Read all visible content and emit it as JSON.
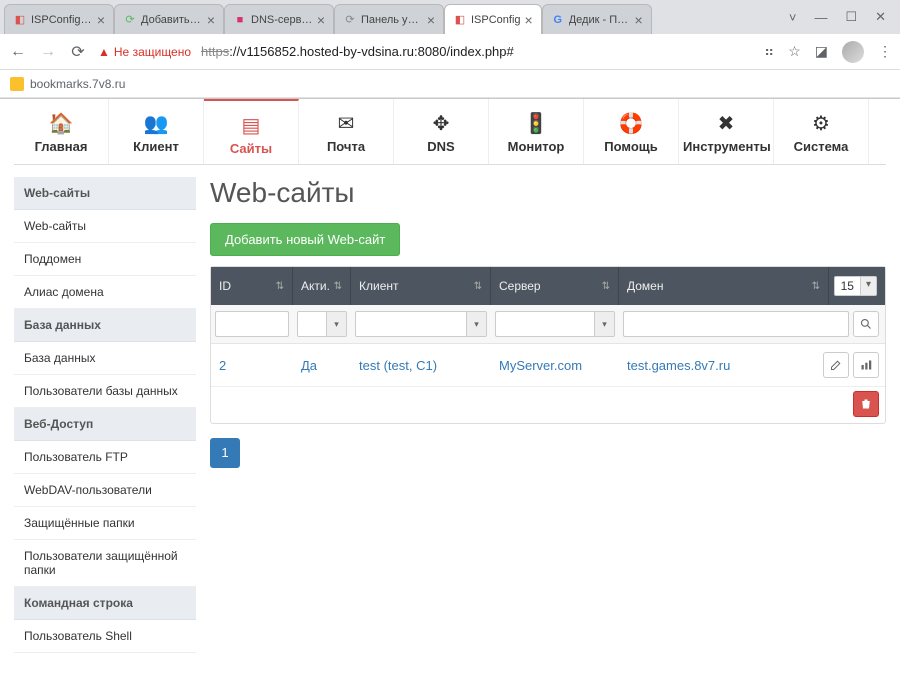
{
  "browser": {
    "tabs": [
      {
        "title": "ISPConfig Host"
      },
      {
        "title": "Добавить тов…"
      },
      {
        "title": "DNS-серверы"
      },
      {
        "title": "Панель управл"
      },
      {
        "title": "ISPConfig"
      },
      {
        "title": "Дедик - Поиск"
      }
    ],
    "not_secure_label": "Не защищено",
    "url_proto": "https",
    "url_rest": "://v1156852.hosted-by-vdsina.ru:8080/index.php#",
    "bookmark": "bookmarks.7v8.ru"
  },
  "topnav": {
    "items": [
      {
        "label": "Главная"
      },
      {
        "label": "Клиент"
      },
      {
        "label": "Сайты"
      },
      {
        "label": "Почта"
      },
      {
        "label": "DNS"
      },
      {
        "label": "Монитор"
      },
      {
        "label": "Помощь"
      },
      {
        "label": "Инструменты"
      },
      {
        "label": "Система"
      }
    ]
  },
  "sidebar": {
    "s0": "Web-сайты",
    "i0": "Web-сайты",
    "i1": "Поддомен",
    "i2": "Алиас домена",
    "s1": "База данных",
    "i3": "База данных",
    "i4": "Пользователи базы данных",
    "s2": "Веб-Доступ",
    "i5": "Пользователь FTP",
    "i6": "WebDAV-пользователи",
    "i7": "Защищённые папки",
    "i8": "Пользователи защищённой папки",
    "s3": "Командная строка",
    "i9": "Пользователь Shell"
  },
  "content": {
    "page_title": "Web-сайты",
    "add_button": "Добавить новый Web-сайт",
    "columns": {
      "id": "ID",
      "active": "Акти.",
      "client": "Клиент",
      "server": "Сервер",
      "domain": "Домен"
    },
    "page_size": "15",
    "rows": [
      {
        "id": "2",
        "active": "Да",
        "client": "test (test, C1)",
        "server": "MyServer.com",
        "domain": "test.games.8v7.ru"
      }
    ],
    "pagination_current": "1"
  }
}
